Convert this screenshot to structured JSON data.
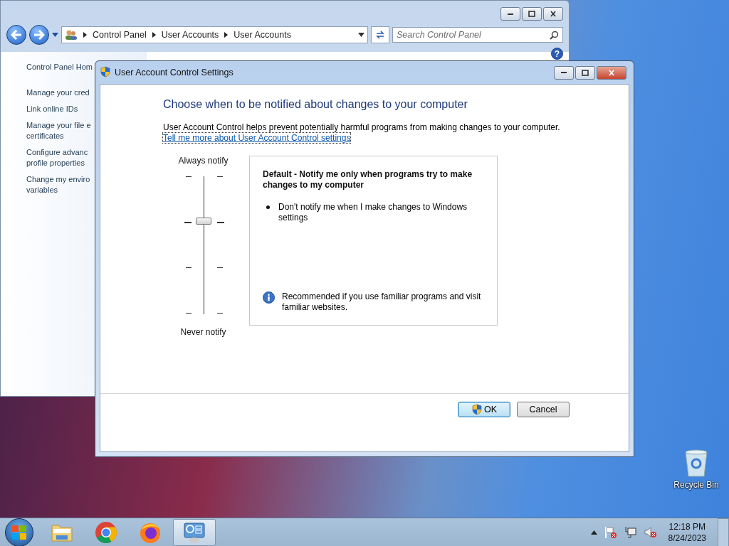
{
  "explorer": {
    "help": "?",
    "breadcrumb": [
      "Control Panel",
      "User Accounts",
      "User Accounts"
    ],
    "search": {
      "placeholder": "Search Control Panel"
    },
    "sidebar": {
      "items": [
        {
          "lines": [
            "Control Panel Hom"
          ]
        },
        {
          "lines": [
            "Manage your cred"
          ]
        },
        {
          "lines": [
            "Link online IDs"
          ]
        },
        {
          "lines": [
            "Manage your file e",
            "certificates"
          ]
        },
        {
          "lines": [
            "Configure advanc",
            "profile properties"
          ]
        },
        {
          "lines": [
            "Change my enviro",
            "variables"
          ]
        }
      ]
    }
  },
  "dialog": {
    "title": "User Account Control Settings",
    "heading": "Choose when to be notified about changes to your computer",
    "description": "User Account Control helps prevent potentially harmful programs from making changes to your computer.",
    "link": "Tell me more about User Account Control settings",
    "slider": {
      "top_label": "Always notify",
      "bottom_label": "Never notify",
      "level": 0.67
    },
    "info": {
      "title": "Default - Notify me only when programs try to make changes to my computer",
      "bullets": [
        "Don't notify me when I make changes to Windows settings"
      ],
      "note": "Recommended if you use familiar programs and visit familiar websites."
    },
    "buttons": [
      {
        "label": "OK",
        "kind": "shield",
        "default": true
      },
      {
        "label": "Cancel",
        "kind": "plain",
        "default": false
      }
    ]
  },
  "desktop_icons": [
    {
      "label": "Recycle Bin"
    }
  ],
  "taskbar": {
    "items": [
      {
        "kind": "folder",
        "active": false
      },
      {
        "kind": "chrome",
        "active": false
      },
      {
        "kind": "firefox",
        "active": false
      },
      {
        "kind": "control-panel",
        "active": true
      }
    ],
    "clock": {
      "time": "12:18 PM",
      "date": "8/24/2023"
    }
  }
}
